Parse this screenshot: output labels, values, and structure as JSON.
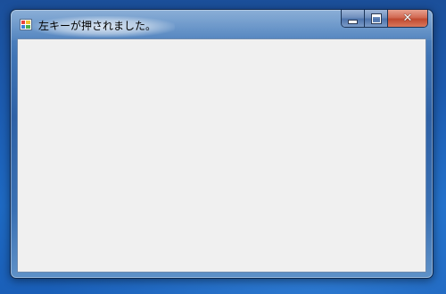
{
  "window": {
    "title": "左キーが押されました。",
    "app_icon": "app-window-icon",
    "controls": {
      "minimize_icon": "minimize-icon",
      "maximize_icon": "maximize-icon",
      "close_icon": "close-icon"
    }
  }
}
